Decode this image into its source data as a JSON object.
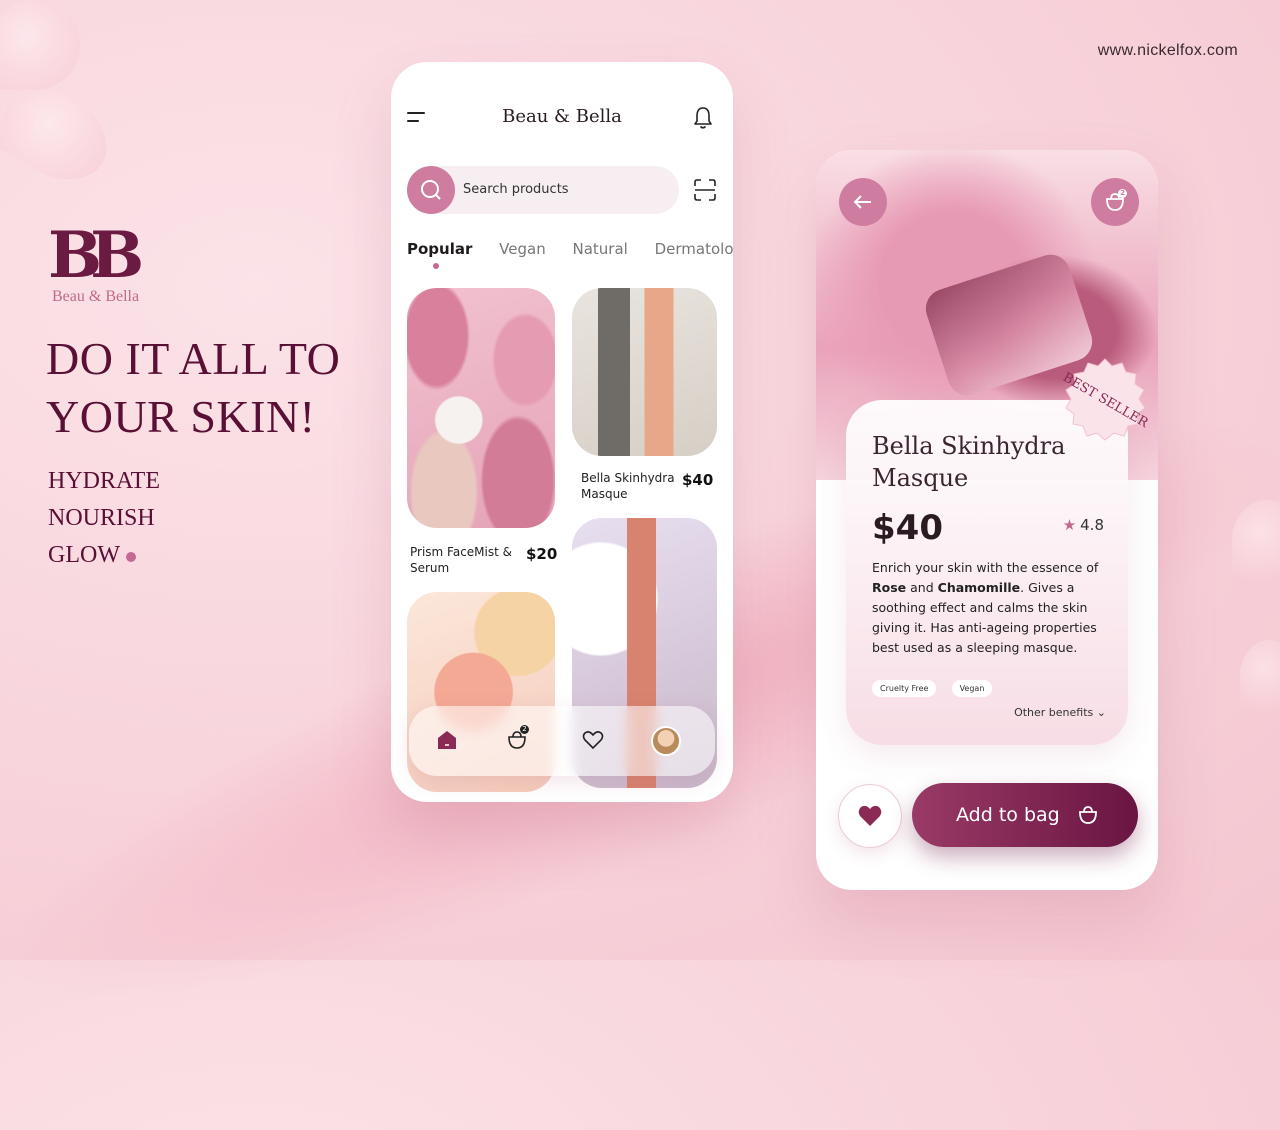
{
  "site_url": "www.nickelfox.com",
  "brand": {
    "monogram": "BB",
    "name": "Beau & Bella"
  },
  "hero": {
    "line1": "DO IT ALL TO",
    "line2": "YOUR SKIN!"
  },
  "benefits": [
    "HYDRATE",
    "NOURISH",
    "GLOW"
  ],
  "colors": {
    "accent": "#cf7ca1",
    "brand": "#6b1a41",
    "button": "#6a1542"
  },
  "home_screen": {
    "title": "Beau & Bella",
    "search_placeholder": "Search products",
    "categories": [
      "Popular",
      "Vegan",
      "Natural",
      "Dermatologi"
    ],
    "active_category": "Popular",
    "products": [
      {
        "name": "Bella Skinhydra Masque",
        "price": "$40"
      },
      {
        "name": "Prism FaceMist & Serum",
        "price": "$20"
      }
    ],
    "bag_count": "2",
    "tab_icons": [
      "home-icon",
      "bag-icon",
      "heart-icon",
      "avatar"
    ]
  },
  "detail_screen": {
    "bag_count": "2",
    "seal_text": "BEST SELLER",
    "product_name": "Bella Skinhydra Masque",
    "price": "$40",
    "rating": "4.8",
    "description": {
      "part1": "Enrich your skin with the essence of",
      "bold1": "Rose",
      "and": "and",
      "bold2": "Chamomille",
      "part2": ". Gives a soothing effect and calms the skin giving it. Has anti-ageing properties best used as a sleeping masque."
    },
    "tags": [
      "Cruelty Free",
      "Vegan"
    ],
    "other_benefits": "Other benefits",
    "add_to_bag": "Add to bag"
  }
}
